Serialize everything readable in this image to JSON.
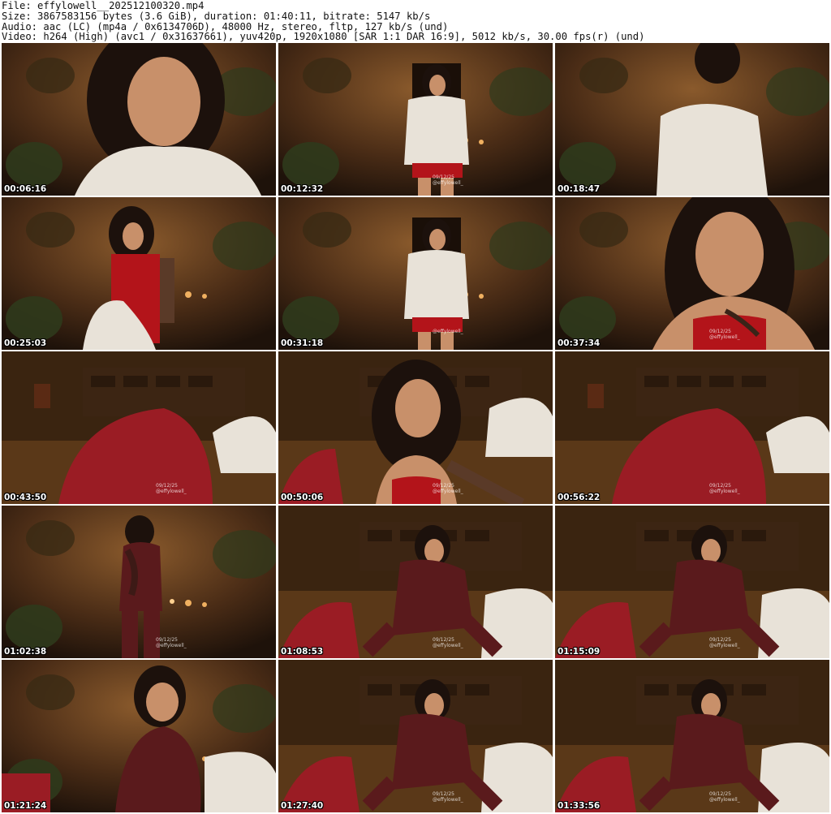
{
  "header": {
    "line1": "File: effylowell__202512100320.mp4",
    "line2": "Size: 3867583156 bytes (3.6 GiB), duration: 01:40:11, bitrate: 5147 kb/s",
    "line3": "Audio: aac (LC) (mp4a / 0x6134706D), 48000 Hz, stereo, fltp, 127 kb/s (und)",
    "line4": "Video: h264 (High) (avc1 / 0x31637661), yuv420p, 1920x1080 [SAR 1:1 DAR 16:9], 5012 kb/s, 30.00 fps(r) (und)"
  },
  "thumbnails": [
    {
      "timestamp": "00:06:16",
      "watermark_date": "",
      "watermark_handle": "",
      "palette": "warm-closeup-white"
    },
    {
      "timestamp": "00:12:32",
      "watermark_date": "09/12/25",
      "watermark_handle": "@effylowell_",
      "palette": "room-white-red"
    },
    {
      "timestamp": "00:18:47",
      "watermark_date": "",
      "watermark_handle": "",
      "palette": "room-white-back"
    },
    {
      "timestamp": "00:25:03",
      "watermark_date": "",
      "watermark_handle": "",
      "palette": "room-red-lingerie"
    },
    {
      "timestamp": "00:31:18",
      "watermark_date": "",
      "watermark_handle": "@effylowell_",
      "palette": "room-white-red"
    },
    {
      "timestamp": "00:37:34",
      "watermark_date": "09/12/25",
      "watermark_handle": "@effylowell_",
      "palette": "closeup-red"
    },
    {
      "timestamp": "00:43:50",
      "watermark_date": "09/12/25",
      "watermark_handle": "@effylowell_",
      "palette": "floor-chair"
    },
    {
      "timestamp": "00:50:06",
      "watermark_date": "09/12/25",
      "watermark_handle": "@effylowell_",
      "palette": "floor-closeup-red"
    },
    {
      "timestamp": "00:56:22",
      "watermark_date": "09/12/25",
      "watermark_handle": "@effylowell_",
      "palette": "floor-chair"
    },
    {
      "timestamp": "01:02:38",
      "watermark_date": "09/12/25",
      "watermark_handle": "@effylowell_",
      "palette": "room-maroon"
    },
    {
      "timestamp": "01:08:53",
      "watermark_date": "09/12/25",
      "watermark_handle": "@effylowell_",
      "palette": "floor-maroon"
    },
    {
      "timestamp": "01:15:09",
      "watermark_date": "09/12/25",
      "watermark_handle": "@effylowell_",
      "palette": "floor-maroon"
    },
    {
      "timestamp": "01:21:24",
      "watermark_date": "",
      "watermark_handle": "",
      "palette": "room-maroon-close"
    },
    {
      "timestamp": "01:27:40",
      "watermark_date": "09/12/25",
      "watermark_handle": "@effylowell_",
      "palette": "floor-maroon"
    },
    {
      "timestamp": "01:33:56",
      "watermark_date": "09/12/25",
      "watermark_handle": "@effylowell_",
      "palette": "floor-maroon"
    }
  ],
  "colors": {
    "room_dark": "#2b1a10",
    "room_warm": "#7a4a22",
    "lamp_glow": "#f0b060",
    "white_sweater": "#e8e2d8",
    "red_garment": "#b3141a",
    "maroon_suit": "#5a1a1c",
    "skin": "#c8906a",
    "hair": "#1c110c",
    "plant": "#2f3a1c",
    "gingham_red": "#9a1c24"
  }
}
